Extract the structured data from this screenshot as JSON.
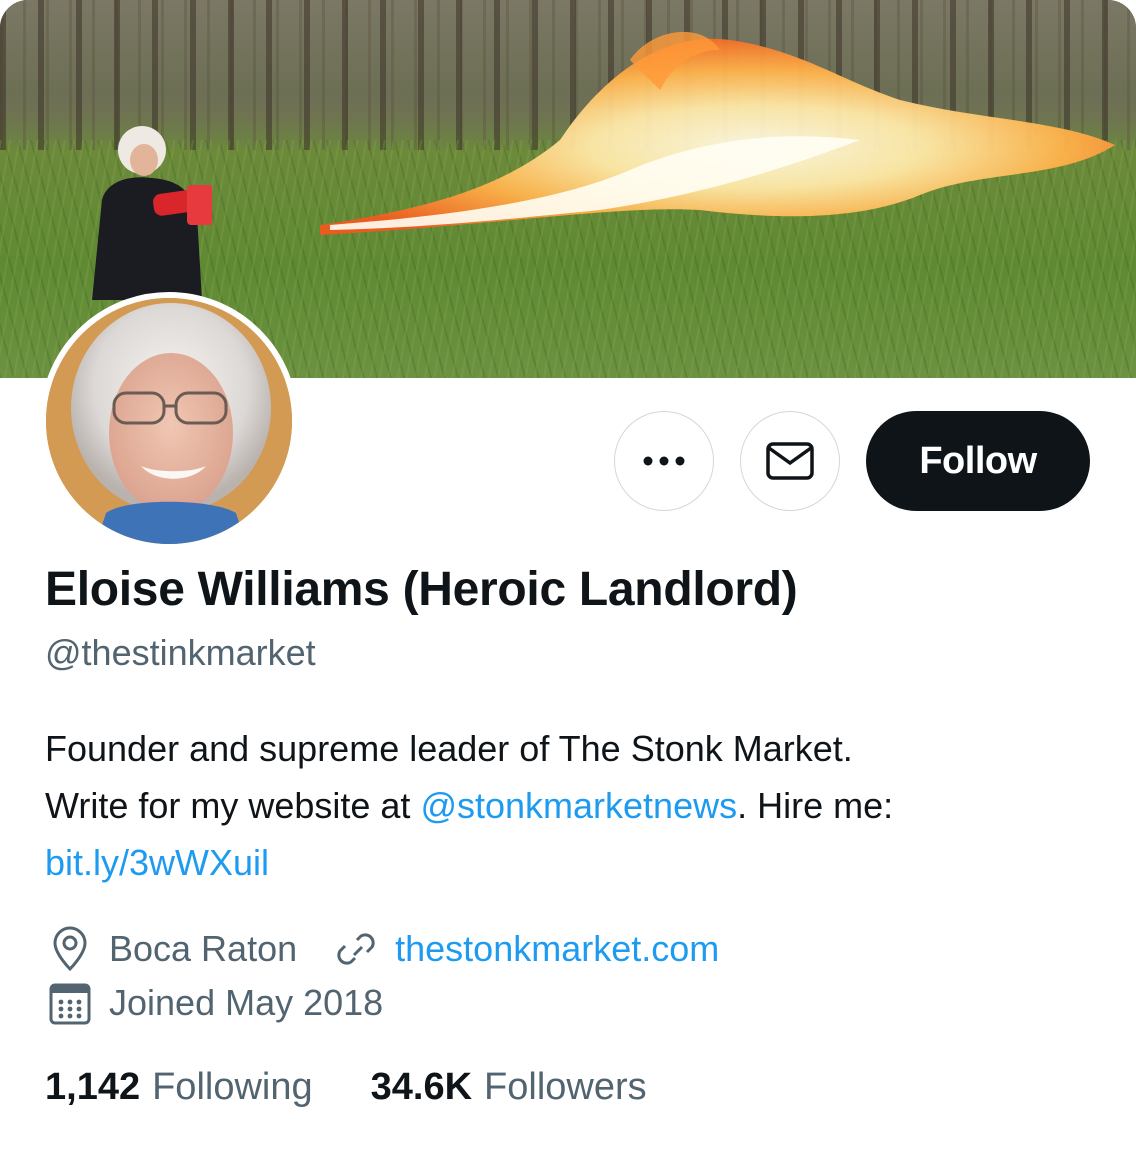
{
  "profile": {
    "name": "Eloise Williams (Heroic Landlord)",
    "handle": "@thestinkmarket",
    "bio": {
      "line1": "Founder and supreme leader of The Stonk Market.",
      "line2_prefix": "Write for my website at ",
      "line2_mention": "@stonkmarketnews",
      "line2_suffix": ". Hire me:",
      "line3_link": "bit.ly/3wWXuil"
    },
    "location": "Boca Raton",
    "website": "thestonkmarket.com",
    "joined": "Joined May 2018"
  },
  "actions": {
    "more_icon": "more-icon",
    "message_icon": "mail-icon",
    "follow_label": "Follow"
  },
  "stats": {
    "following_count": "1,142",
    "following_label": "Following",
    "followers_count": "34.6K",
    "followers_label": "Followers"
  },
  "colors": {
    "link": "#1d9bf0",
    "secondary_text": "#536471",
    "primary_text": "#0f1419",
    "follow_bg": "#0f1419"
  }
}
